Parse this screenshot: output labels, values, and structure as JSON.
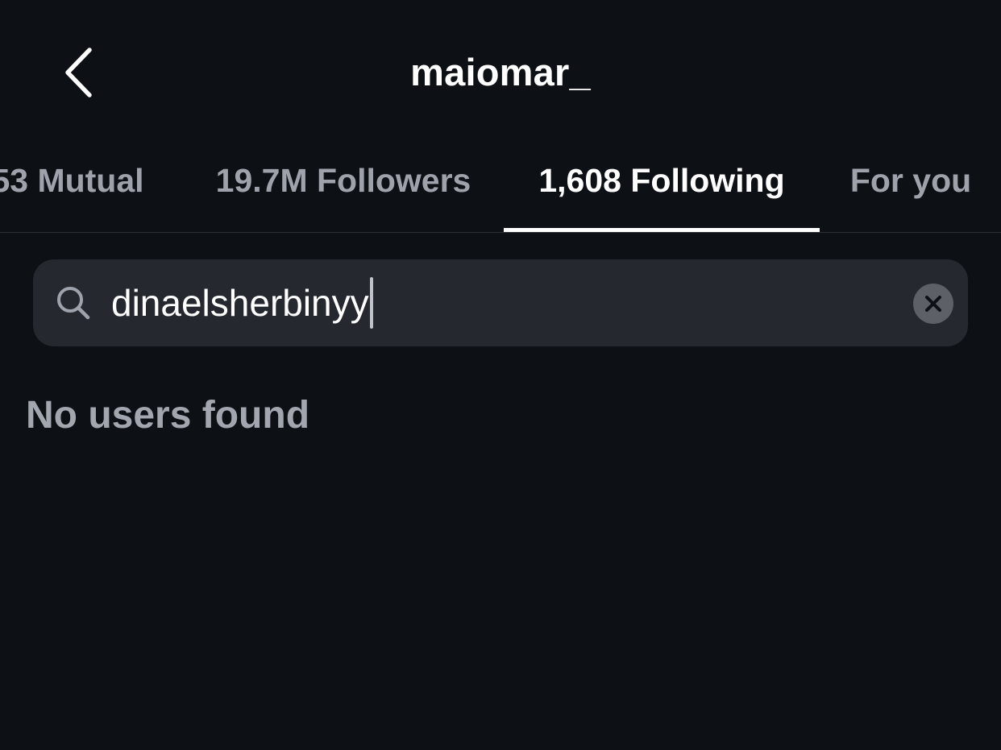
{
  "header": {
    "title": "maiomar_",
    "back_icon": "chevron-left-icon"
  },
  "tabs": [
    {
      "label": "53 Mutual",
      "active": false
    },
    {
      "label": "19.7M Followers",
      "active": false
    },
    {
      "label": "1,608 Following",
      "active": true
    },
    {
      "label": "For you",
      "active": false
    }
  ],
  "search": {
    "value": "dinaelsherbinyy",
    "search_icon": "search-icon",
    "clear_icon": "clear-icon"
  },
  "results": {
    "empty_message": "No users found"
  },
  "colors": {
    "background": "#0d1015",
    "search_field": "#25282e",
    "inactive_tab": "#9ea2aa",
    "active_tab": "#ffffff"
  }
}
